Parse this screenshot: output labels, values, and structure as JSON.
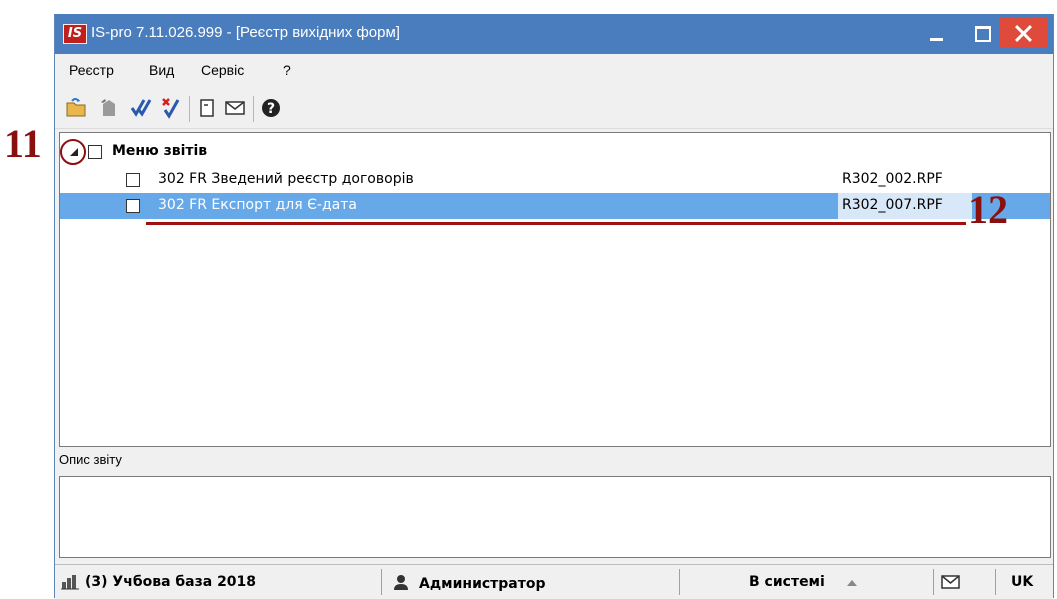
{
  "window": {
    "app_logo": "IS",
    "title": "IS-pro 7.11.026.999 - [Реєстр вихідних форм]"
  },
  "menubar": {
    "items": [
      {
        "label": "Реєстр"
      },
      {
        "label": "Вид"
      },
      {
        "label": "Сервіс"
      },
      {
        "label": "?"
      }
    ]
  },
  "toolbar": {
    "icons": [
      "open-folder-icon",
      "document-gray-icon",
      "check-all-icon",
      "uncheck-all-icon",
      "form-icon",
      "envelope-icon",
      "help-icon"
    ]
  },
  "tree": {
    "root": {
      "label": "Меню звітів",
      "expanded": true
    },
    "items": [
      {
        "label": "302 FR Зведений реєстр договорів",
        "file": "R302_002.RPF",
        "selected": false
      },
      {
        "label": "302 FR Експорт для Є-дата",
        "file": "R302_007.RPF",
        "selected": true
      }
    ]
  },
  "description": {
    "label": "Опис звіту"
  },
  "statusbar": {
    "database": "(3) Учбова база 2018",
    "user": "Администратор",
    "state": "В системі",
    "lang": "UK"
  },
  "annotations": {
    "callout_11": "11",
    "callout_12": "12"
  },
  "colors": {
    "titlebar": "#4a7dbd",
    "close_button": "#e04a3a",
    "selection": "#66a8e8",
    "annotation": "#8a1010"
  }
}
